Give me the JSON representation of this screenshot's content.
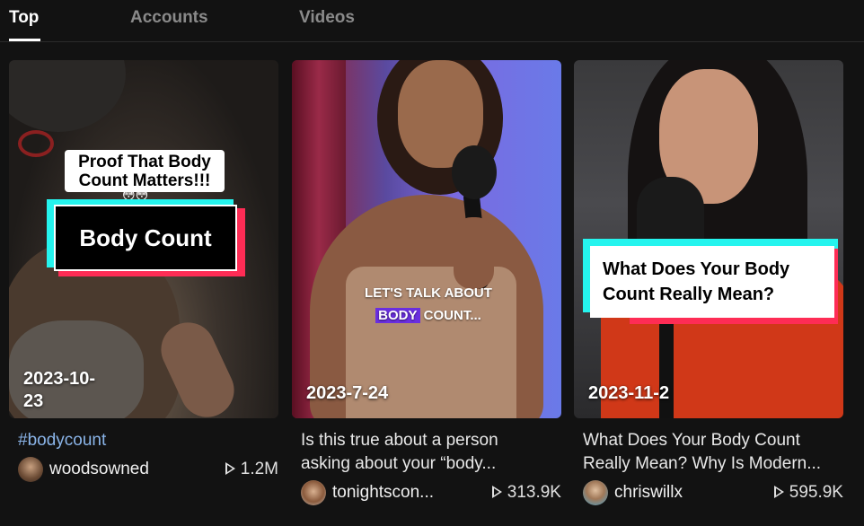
{
  "tabs": [
    {
      "label": "Top",
      "active": true
    },
    {
      "label": "Accounts",
      "active": false
    },
    {
      "label": "Videos",
      "active": false
    }
  ],
  "cards": [
    {
      "date": "2023-10-23",
      "date_line1": "2023-10-",
      "date_line2": "23",
      "overlay_top": "Proof That Body Count Matters!!!",
      "overlay_emoji": "😳😳",
      "overlay_main": "Body Count",
      "caption": "#bodycount",
      "username": "woodsowned",
      "views": "1.2M"
    },
    {
      "date": "2023-7-24",
      "overlay_line1": "LET'S TALK ABOUT",
      "overlay_highlight": "BODY",
      "overlay_line2_rest": " COUNT...",
      "caption_line1": "Is this true about a person",
      "caption_line2": "asking about your “body...",
      "username": "tonightscon...",
      "views": "313.9K"
    },
    {
      "date": "2023-11-2",
      "overlay_line1": "What Does Your Body",
      "overlay_line2": "Count Really Mean?",
      "caption_line1": "What Does Your Body Count",
      "caption_line2": "Really Mean? Why Is Modern...",
      "username": "chriswillx",
      "views": "595.9K"
    }
  ],
  "colors": {
    "background": "#121212",
    "hashtag": "#8ab4e8",
    "tiktok_cyan": "#25f4ee",
    "tiktok_red": "#fe2c55",
    "highlight_purple": "#6a2fe0"
  }
}
